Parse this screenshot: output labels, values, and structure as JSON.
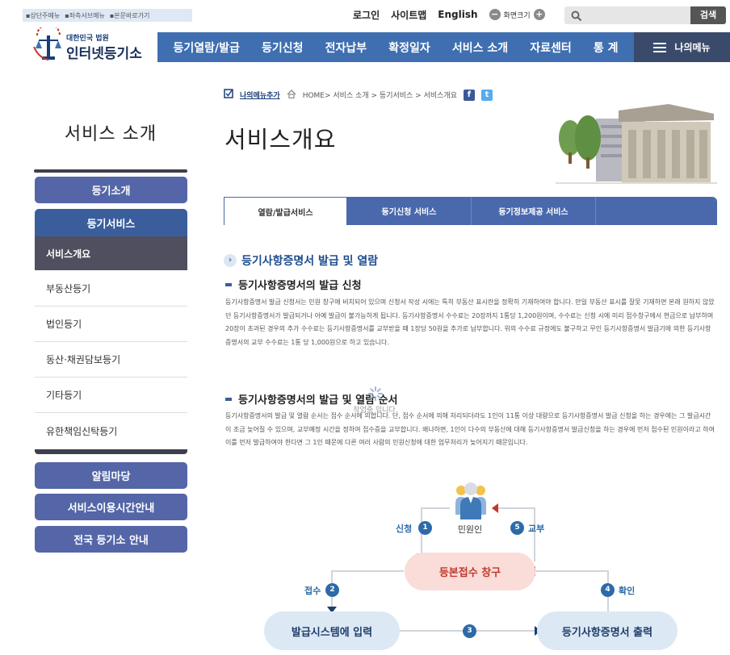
{
  "skip_nav": [
    "▪상단주메뉴",
    "▪좌측서브메뉴",
    "▪본문바로가기"
  ],
  "top_links": {
    "login": "로그인",
    "sitemap": "사이트맵",
    "english": "English",
    "zoom_label": "화면크기",
    "zoom_out": "−",
    "zoom_in": "+"
  },
  "search": {
    "placeholder": "",
    "button": "검색",
    "icon": "search-icon"
  },
  "logo": {
    "org_small": "대한민국 법원",
    "title": "인터넷등기소",
    "icon": "court-emblem-icon"
  },
  "gnb": [
    "등기열람/발급",
    "등기신청",
    "전자납부",
    "확정일자",
    "서비스 소개",
    "자료센터",
    "통 계"
  ],
  "my_menu": "나의메뉴",
  "sidebar": {
    "title": "서비스 소개",
    "intro": "등기소개",
    "service": "등기서비스",
    "sub_items": [
      "서비스개요",
      "부동산등기",
      "법인등기",
      "동산·채권담보등기",
      "기타등기",
      "유한책임신탁등기"
    ],
    "bottom_buttons": [
      "알림마당",
      "서비스이용시간안내",
      "전국 등기소 안내"
    ]
  },
  "breadcrumb": {
    "add_my_menu": "나의메뉴추가",
    "path": "HOME> 서비스 소개 > 등기서비스 > 서비스개요",
    "facebook": "f",
    "twitter": "t"
  },
  "page_title": "서비스개요",
  "tabs": [
    "열람/발급서비스",
    "등기신청 서비스",
    "등기정보제공 서비스"
  ],
  "content": {
    "section_title": "등기사항증명서 발급 및 열람",
    "sub1_title": "등기사항증명서의 발급 신청",
    "sub1_text": "등기사항증명서 발급 신청서는 민원 창구에 비치되어 있으며 신청서 작성 시에는 특히 부동산 표시란을 정확히 기재하여야 합니다. 만일 부동산 표시를 잘못 기재하면 본래 원하지 않았던 등기사항증명서가 발급되거나 아예 발급이 불가능하게 됩니다. 등기사항증명서 수수료는 20장까지 1통당 1,200원이며, 수수료는 신청 시에 미리 접수창구에서 현금으로 납부하며 20장이 초과된 경우의 추가 수수료는 등기사항증명서를 교부받을 때 1장당 50원을 추가로 납부합니다. 위의 수수료 규정에도 불구하고 무인 등기사항증명서 발급기에 의한 등기사항증명서의 교부 수수료는 1통 당 1,000원으로 하고 있습니다.",
    "sub2_title": "등기사항증명서의 발급 및 열람 순서",
    "sub2_text": "등기사항증명서의 발급 및 열람 순서는 접수 순서에 의합니다. 단, 접수 순서에 의해 처리되더라도 1인이 11통 이상 대량으로 등기사항증명서 발급 신청을 하는 경우에는 그 발급시간이 조금 늦어질 수 있으며, 교부예정 시간을 정하여 접수증을 교부합니다. 왜냐하면, 1인이 다수의 부동산에 대해 등기사항증명서 발급신청을 하는 경우에 먼저 접수된 민원이라고 하여 이를 먼저 발급하여야 한다면 그 1인 때문에 다른 여러 사람의 민원신청에 대한 업무처리가 늦어지기 때문입니다.",
    "loading_text": "작업중 입니다."
  },
  "diagram": {
    "person": "민원인",
    "counter": "등본접수 창구",
    "system": "발급시스템에 입력",
    "output": "등기사항증명서 출력",
    "steps": [
      {
        "num": "1",
        "label": "신청"
      },
      {
        "num": "2",
        "label": "접수"
      },
      {
        "num": "3",
        "label": ""
      },
      {
        "num": "4",
        "label": "확인"
      },
      {
        "num": "5",
        "label": "교부"
      }
    ]
  }
}
